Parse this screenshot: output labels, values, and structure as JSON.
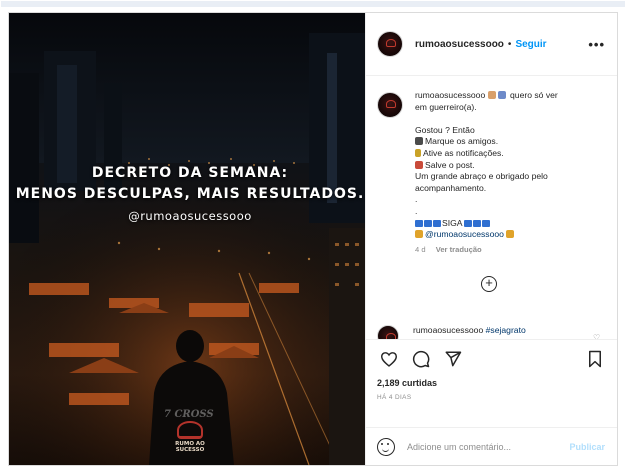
{
  "post": {
    "overlay": {
      "line1": "DECRETO DA SEMANA:",
      "line2": "MENOS DESCULPAS, MAIS RESULTADOS.",
      "handle": "@rumoaosucessooo",
      "logo_line1": "RUMO AO",
      "logo_line2": "SUCESSO",
      "watermark": "7 CROSS"
    }
  },
  "header": {
    "username": "rumoaosucessooo",
    "separator": "•",
    "follow_label": "Seguir",
    "more_label": "•••"
  },
  "caption": {
    "username": "rumoaosucessooo",
    "line1_text": "quero só ver",
    "line2": "em guerreiro(a).",
    "line3": "Gostou ? Então",
    "line4": "Marque os amigos.",
    "line5": "Ative as notificações.",
    "line6": "Salve o post.",
    "line7": "Um grande abraço e obrigado pelo",
    "line8": "acompanhamento.",
    "dot1": ".",
    "dot2": ".",
    "siga": "SIGA",
    "mention": "@rumoaosucessooo",
    "age": "4 d",
    "translate": "Ver tradução"
  },
  "comment_peek": {
    "username": "rumoaosucessooo",
    "hashtag": "#sejagrato"
  },
  "actions": {
    "like_icon": "heart-icon",
    "comment_icon": "comment-icon",
    "share_icon": "send-icon",
    "save_icon": "bookmark-icon"
  },
  "likes": "2,189 curtidas",
  "ago": "HÁ 4 DIAS",
  "comment_box": {
    "placeholder": "Adicione um comentário...",
    "publish_label": "Publicar"
  },
  "colors": {
    "link": "#0095f6",
    "publish_disabled": "#b2dffc",
    "muted": "#8e8e8e"
  }
}
